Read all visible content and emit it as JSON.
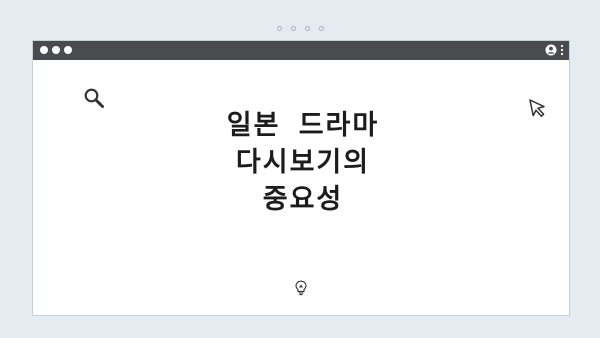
{
  "page": {
    "title_lines": [
      "일본 드라마",
      "다시보기의",
      "중요성"
    ]
  },
  "icons": {
    "search": "search-icon",
    "cursor": "cursor-arrow-icon",
    "lightbulb": "lightbulb-icon",
    "profile": "profile-icon",
    "menu": "kebab-menu-icon"
  },
  "colors": {
    "background": "#e4ebf1",
    "titlebar": "#4a4b4e",
    "window": "#ffffff",
    "text": "#1c1c1c"
  }
}
